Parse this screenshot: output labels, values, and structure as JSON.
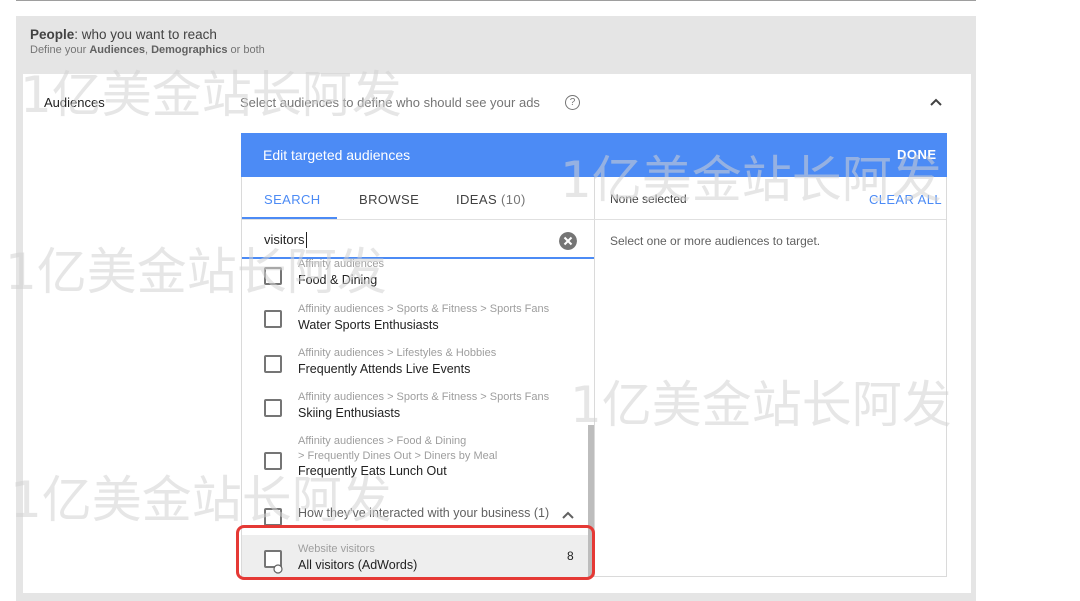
{
  "section": {
    "title_bold": "People",
    "title_rest": ": who you want to reach",
    "subtitle_pre": "Define your ",
    "subtitle_a": "Audiences",
    "subtitle_sep": ", ",
    "subtitle_b": "Demographics",
    "subtitle_post": " or both"
  },
  "audiences": {
    "label": "Audiences",
    "hint": "Select audiences to define who should see your ads",
    "help_glyph": "?"
  },
  "editor": {
    "title": "Edit targeted audiences",
    "done_label": "DONE",
    "tabs": {
      "search": "SEARCH",
      "browse": "BROWSE",
      "ideas": "IDEAS",
      "ideas_count": "(10)"
    },
    "search_value": "visitors",
    "results": [
      {
        "path": "Affinity audiences",
        "name": "Food & Dining"
      },
      {
        "path": "Affinity audiences > Sports & Fitness > Sports Fans",
        "name": "Water Sports Enthusiasts"
      },
      {
        "path": "Affinity audiences > Lifestyles & Hobbies",
        "name": "Frequently Attends Live Events"
      },
      {
        "path": "Affinity audiences > Sports & Fitness > Sports Fans",
        "name": "Skiing Enthusiasts"
      },
      {
        "path": "Affinity audiences > Food & Dining",
        "path2": "> Frequently Dines Out > Diners by Meal",
        "name": "Frequently Eats Lunch Out"
      }
    ],
    "group": {
      "label": "How they've interacted with your business (1)"
    },
    "website_visitors": {
      "path": "Website visitors",
      "name": "All visitors (AdWords)",
      "count": "8"
    },
    "selected": {
      "none_selected": "None selected",
      "clear_all": "CLEAR ALL",
      "hint": "Select one or more audiences to target."
    }
  },
  "watermark": "1亿美金站长阿发",
  "colors": {
    "accent": "#4c8bf5",
    "highlight": "#e53935"
  }
}
